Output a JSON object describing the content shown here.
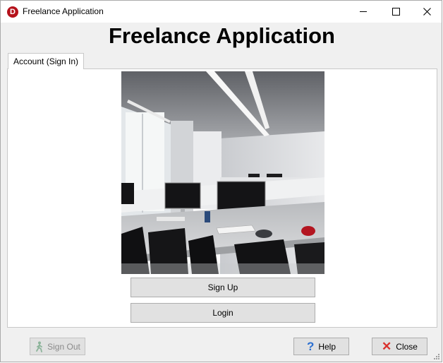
{
  "window": {
    "title": "Freelance Application",
    "app_icon_letter": "D",
    "controls": {
      "minimize": "minimize",
      "maximize": "maximize",
      "close": "close"
    }
  },
  "heading": "Freelance Application",
  "tabs": [
    {
      "label": "Account (Sign In)",
      "active": true
    }
  ],
  "main": {
    "image": "office-photo",
    "sign_up_label": "Sign Up",
    "login_label": "Login"
  },
  "footer": {
    "sign_out_label": "Sign Out",
    "sign_out_enabled": false,
    "help_label": "Help",
    "close_label": "Close"
  },
  "icons": {
    "help": "question-icon",
    "close": "x-icon",
    "sign_out": "walking-person-icon"
  },
  "colors": {
    "accent_help": "#2b6fd1",
    "accent_close": "#d9302c",
    "app_icon": "#b5121b",
    "button_face": "#e1e1e1",
    "window_bg": "#f0f0f0"
  }
}
